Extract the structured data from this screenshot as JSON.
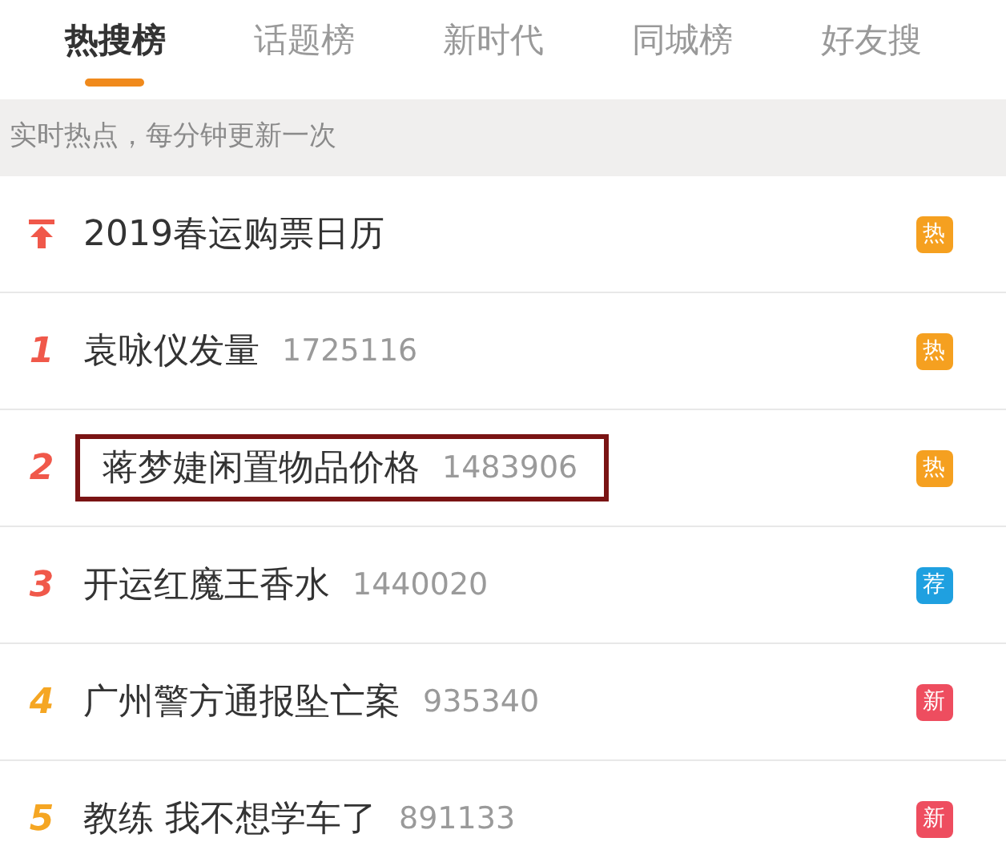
{
  "tabs": [
    {
      "label": "热搜榜",
      "selected": true
    },
    {
      "label": "话题榜",
      "selected": false
    },
    {
      "label": "新时代",
      "selected": false
    },
    {
      "label": "同城榜",
      "selected": false
    },
    {
      "label": "好友搜",
      "selected": false
    }
  ],
  "notice": "实时热点，每分钟更新一次",
  "rows": [
    {
      "kind": "pinned",
      "title": "2019春运购票日历",
      "highlighted": false,
      "badge": {
        "text": "热",
        "color": "#f5a020"
      }
    },
    {
      "kind": "ranked",
      "rank": {
        "text": "1",
        "color": "#f0584a"
      },
      "title": "袁咏仪发量",
      "count": "1725116",
      "highlighted": false,
      "badge": {
        "text": "热",
        "color": "#f5a020"
      }
    },
    {
      "kind": "ranked",
      "rank": {
        "text": "2",
        "color": "#f0584a"
      },
      "title": "蒋梦婕闲置物品价格",
      "count": "1483906",
      "highlighted": true,
      "badge": {
        "text": "热",
        "color": "#f5a020"
      }
    },
    {
      "kind": "ranked",
      "rank": {
        "text": "3",
        "color": "#f0584a"
      },
      "title": "开运红魔王香水",
      "count": "1440020",
      "highlighted": false,
      "badge": {
        "text": "荐",
        "color": "#1fa0e0"
      }
    },
    {
      "kind": "ranked",
      "rank": {
        "text": "4",
        "color": "#f5a623"
      },
      "title": "广州警方通报坠亡案",
      "count": "935340",
      "highlighted": false,
      "badge": {
        "text": "新",
        "color": "#ee4d5f"
      }
    },
    {
      "kind": "ranked",
      "rank": {
        "text": "5",
        "color": "#f5a623"
      },
      "title": "教练 我不想学车了",
      "count": "891133",
      "highlighted": false,
      "badge": {
        "text": "新",
        "color": "#ee4d5f"
      }
    }
  ]
}
